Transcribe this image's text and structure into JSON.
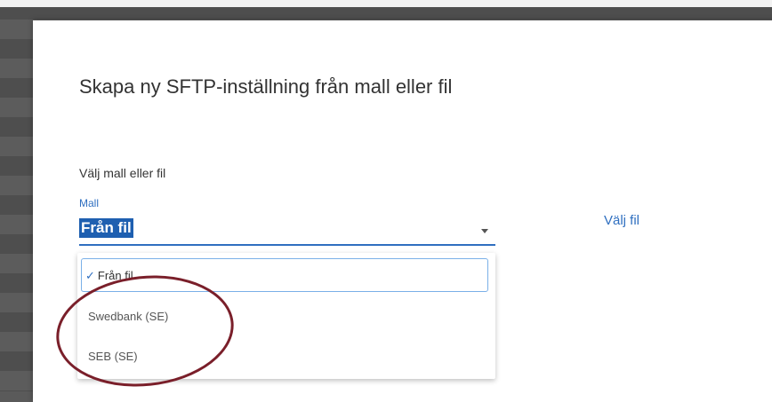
{
  "dialog": {
    "title": "Skapa ny SFTP-inställning från mall eller fil",
    "section_label": "Välj mall eller fil",
    "mall_field": {
      "label": "Mall",
      "selected_value": "Från fil"
    },
    "file_link": "Välj fil",
    "dropdown": {
      "options": [
        {
          "label": "Från fil",
          "selected": true
        },
        {
          "label": "Swedbank (SE)",
          "selected": false
        },
        {
          "label": "SEB (SE)",
          "selected": false
        }
      ]
    }
  },
  "colors": {
    "accent": "#2f6fc0",
    "annotation": "#7a1f2a"
  }
}
